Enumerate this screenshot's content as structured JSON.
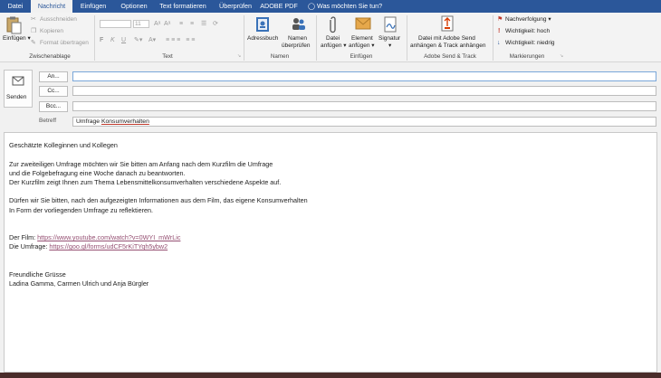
{
  "tabs": [
    "Datei",
    "Nachricht",
    "Einfügen",
    "Optionen",
    "Text formatieren",
    "Überprüfen",
    "ADOBE PDF"
  ],
  "tellme": "Was möchten Sie tun?",
  "clipboard": {
    "paste": "Einfügen",
    "cut": "Ausschneiden",
    "copy": "Kopieren",
    "format": "Format übertragen",
    "label": "Zwischenablage"
  },
  "text_group": {
    "font_size": "11",
    "label": "Text"
  },
  "names_group": {
    "addressbook": "Adressbuch",
    "check_names_1": "Namen",
    "check_names_2": "überprüfen",
    "label": "Namen"
  },
  "insert_group": {
    "file_1": "Datei",
    "file_2": "anfügen",
    "item_1": "Element",
    "item_2": "anfügen",
    "signature": "Signatur",
    "label": "Einfügen"
  },
  "adobe_group": {
    "line1": "Datei mit Adobe Send",
    "line2": "anhängen & Track anhängen",
    "label": "Adobe Send & Track"
  },
  "tags_group": {
    "followup": "Nachverfolgung",
    "high": "Wichtigkeit: hoch",
    "low": "Wichtigkeit: niedrig",
    "label": "Markierungen"
  },
  "compose": {
    "send": "Senden",
    "to": "An...",
    "cc": "Cc...",
    "bcc": "Bcc...",
    "subject_label": "Betreff",
    "subject_plain": "Umfrage ",
    "subject_underlined": "Konsumverhalten"
  },
  "body": {
    "greeting": "Geschätzte Kolleginnen und Kollegen",
    "p1_l1": "Zur zweiteiligen Umfrage möchten wir Sie bitten am Anfang nach dem Kurzfilm die Umfrage",
    "p1_l2": "und die Folgebefragung eine Woche danach zu beantworten.",
    "p1_l3": "Der Kurzfilm zeigt Ihnen zum Thema Lebensmittelkonsumverhalten verschiedene Aspekte auf.",
    "p2_l1": "Dürfen wir Sie bitten, nach den aufgezeigten Informationen aus dem Film, das eigene Konsumverhalten",
    "p2_l2": "In Form der vorliegenden Umfrage zu reflektieren.",
    "film_label": "Der Film: ",
    "film_url": "https://www.youtube.com/watch?v=0WYI_mWrLic",
    "survey_label": "Die Umfrage: ",
    "survey_url": "https://goo.gl/forms/udCF5rKiTYqh5ybw2",
    "closing": "Freundliche Grüsse",
    "names": "Ladina Gamma, Carmen Ulrich und Anja Bürgler"
  }
}
